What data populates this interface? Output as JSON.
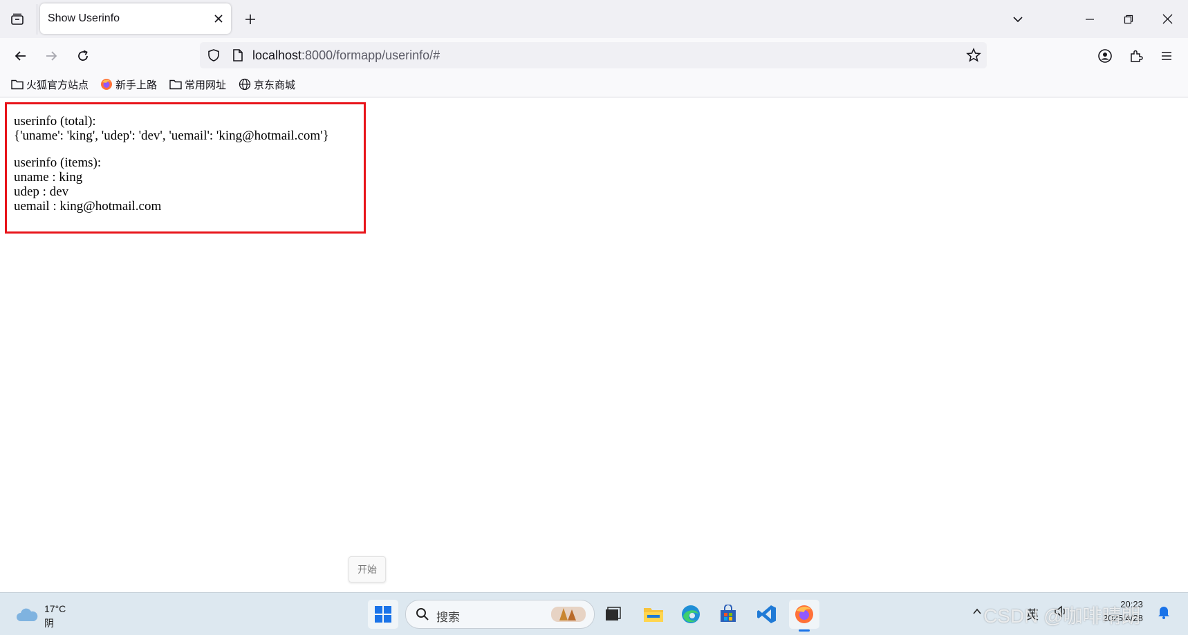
{
  "browser": {
    "tab": {
      "title": "Show Userinfo"
    },
    "url": {
      "host": "localhost",
      "path": ":8000/formapp/userinfo/#"
    },
    "bookmarks": [
      {
        "label": "火狐官方站点",
        "icon": "folder-icon"
      },
      {
        "label": "新手上路",
        "icon": "firefox-icon"
      },
      {
        "label": "常用网址",
        "icon": "folder-icon"
      },
      {
        "label": "京东商城",
        "icon": "globe-icon"
      }
    ]
  },
  "page": {
    "total_heading": "userinfo (total):",
    "total_value": "{'uname': 'king', 'udep': 'dev', 'uemail': 'king@hotmail.com'}",
    "items_heading": "userinfo (items):",
    "items": [
      "uname : king",
      "udep : dev",
      "uemail : king@hotmail.com"
    ],
    "highlight_color": "#e8141a"
  },
  "taskbar": {
    "start_tooltip": "开始",
    "weather": {
      "temp": "17°C",
      "desc": "阴"
    },
    "search_placeholder": "搜索",
    "tray_ime": "英",
    "clock_time": "20:23",
    "clock_date": "2025/4/28",
    "watermark": "CSDN @咖啡晴朗"
  }
}
